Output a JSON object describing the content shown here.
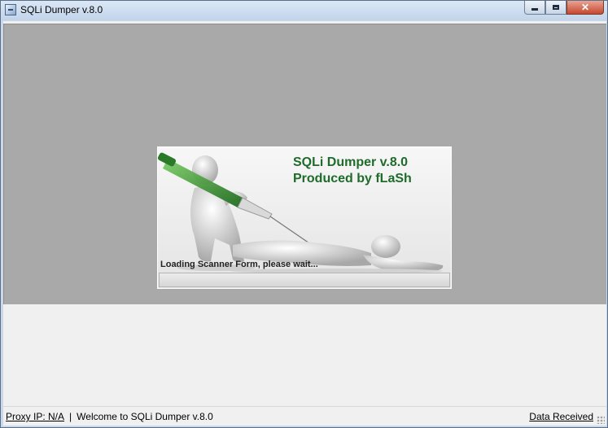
{
  "window": {
    "title": "SQLi Dumper v.8.0",
    "icon": "app-icon"
  },
  "splash": {
    "title": "SQLi Dumper v.8.0",
    "subtitle": "Produced by fLaSh",
    "loading_text": "Loading Scanner Form, please wait...",
    "progress": 0,
    "accent_color": "#1e6b2a"
  },
  "statusbar": {
    "proxy": "Proxy IP: N/A",
    "separator": "|",
    "welcome": "Welcome to SQLi Dumper v.8.0",
    "data_received": "Data Received"
  }
}
